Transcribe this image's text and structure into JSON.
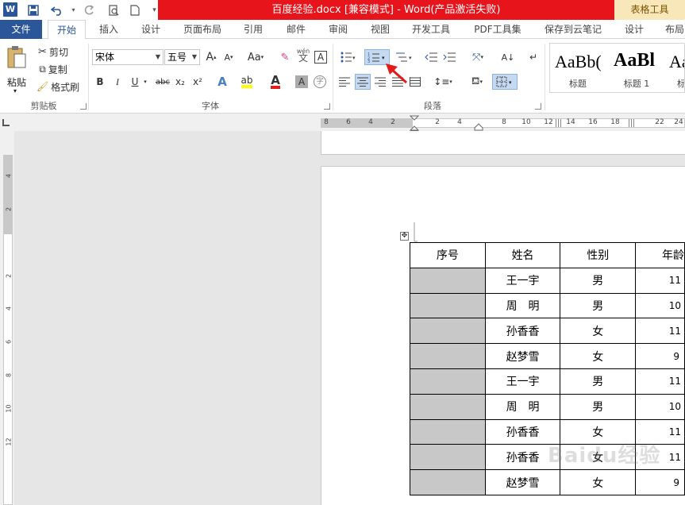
{
  "window": {
    "title": "百度经验.docx [兼容模式] - Word(产品激活失败)",
    "context_tab_group": "表格工具"
  },
  "quick_access": {
    "app_icon": "word-icon",
    "items": [
      "save-icon",
      "undo-icon",
      "redo-icon",
      "print-preview-icon",
      "new-doc-icon",
      "customize-icon"
    ]
  },
  "tabs": [
    {
      "label": "文件"
    },
    {
      "label": "开始"
    },
    {
      "label": "插入"
    },
    {
      "label": "设计"
    },
    {
      "label": "页面布局"
    },
    {
      "label": "引用"
    },
    {
      "label": "邮件"
    },
    {
      "label": "审阅"
    },
    {
      "label": "视图"
    },
    {
      "label": "开发工具"
    },
    {
      "label": "PDF工具集"
    },
    {
      "label": "保存到云笔记"
    },
    {
      "label": "设计"
    },
    {
      "label": "布局"
    }
  ],
  "ribbon": {
    "clipboard": {
      "group_label": "剪贴板",
      "paste_label": "粘贴",
      "cut_label": "剪切",
      "copy_label": "复制",
      "format_painter_label": "格式刷"
    },
    "font": {
      "group_label": "字体",
      "font_name": "宋体",
      "font_size": "五号",
      "grow": "A",
      "shrink": "A",
      "change_case": "Aa",
      "phonetic": "wén",
      "bold": "B",
      "italic": "I",
      "underline": "U",
      "strike": "abc",
      "subscript": "x₂",
      "superscript": "x²",
      "text_effects": "A",
      "font_color": "A",
      "char_shading": "A",
      "enclose": "字"
    },
    "paragraph": {
      "group_label": "段落"
    },
    "styles": {
      "items": [
        {
          "preview": "AaBb(",
          "name": "标题"
        },
        {
          "preview": "AaBl",
          "name": "标题 1"
        },
        {
          "preview": "Aa",
          "name": "标"
        }
      ]
    }
  },
  "ruler": {
    "h_numbers": [
      "8",
      "6",
      "4",
      "2",
      "2",
      "4",
      "8",
      "10",
      "12",
      "14",
      "16",
      "18",
      "22",
      "24"
    ],
    "v_numbers": [
      "4",
      "2",
      "2",
      "4",
      "6",
      "8",
      "10",
      "12"
    ]
  },
  "table": {
    "headers": [
      "序号",
      "姓名",
      "性别",
      "年龄"
    ],
    "rows": [
      {
        "seq": "",
        "name": "王一宇",
        "gender": "男",
        "age": "11"
      },
      {
        "seq": "",
        "name": "周　明",
        "gender": "男",
        "age": "10"
      },
      {
        "seq": "",
        "name": "孙香香",
        "gender": "女",
        "age": "11"
      },
      {
        "seq": "",
        "name": "赵梦雪",
        "gender": "女",
        "age": "9"
      },
      {
        "seq": "",
        "name": "王一宇",
        "gender": "男",
        "age": "11"
      },
      {
        "seq": "",
        "name": "周　明",
        "gender": "男",
        "age": "10"
      },
      {
        "seq": "",
        "name": "孙香香",
        "gender": "女",
        "age": "11"
      },
      {
        "seq": "",
        "name": "孙香香",
        "gender": "女",
        "age": "11"
      },
      {
        "seq": "",
        "name": "赵梦雪",
        "gender": "女",
        "age": "9"
      }
    ]
  },
  "watermark": "Baidu经验",
  "colors": {
    "title_bar": "#e8141c",
    "file_tab": "#2b579a",
    "context_tab": "#f8e7b8",
    "selection": "#c8c8c8",
    "arrow": "#e21b1b"
  }
}
